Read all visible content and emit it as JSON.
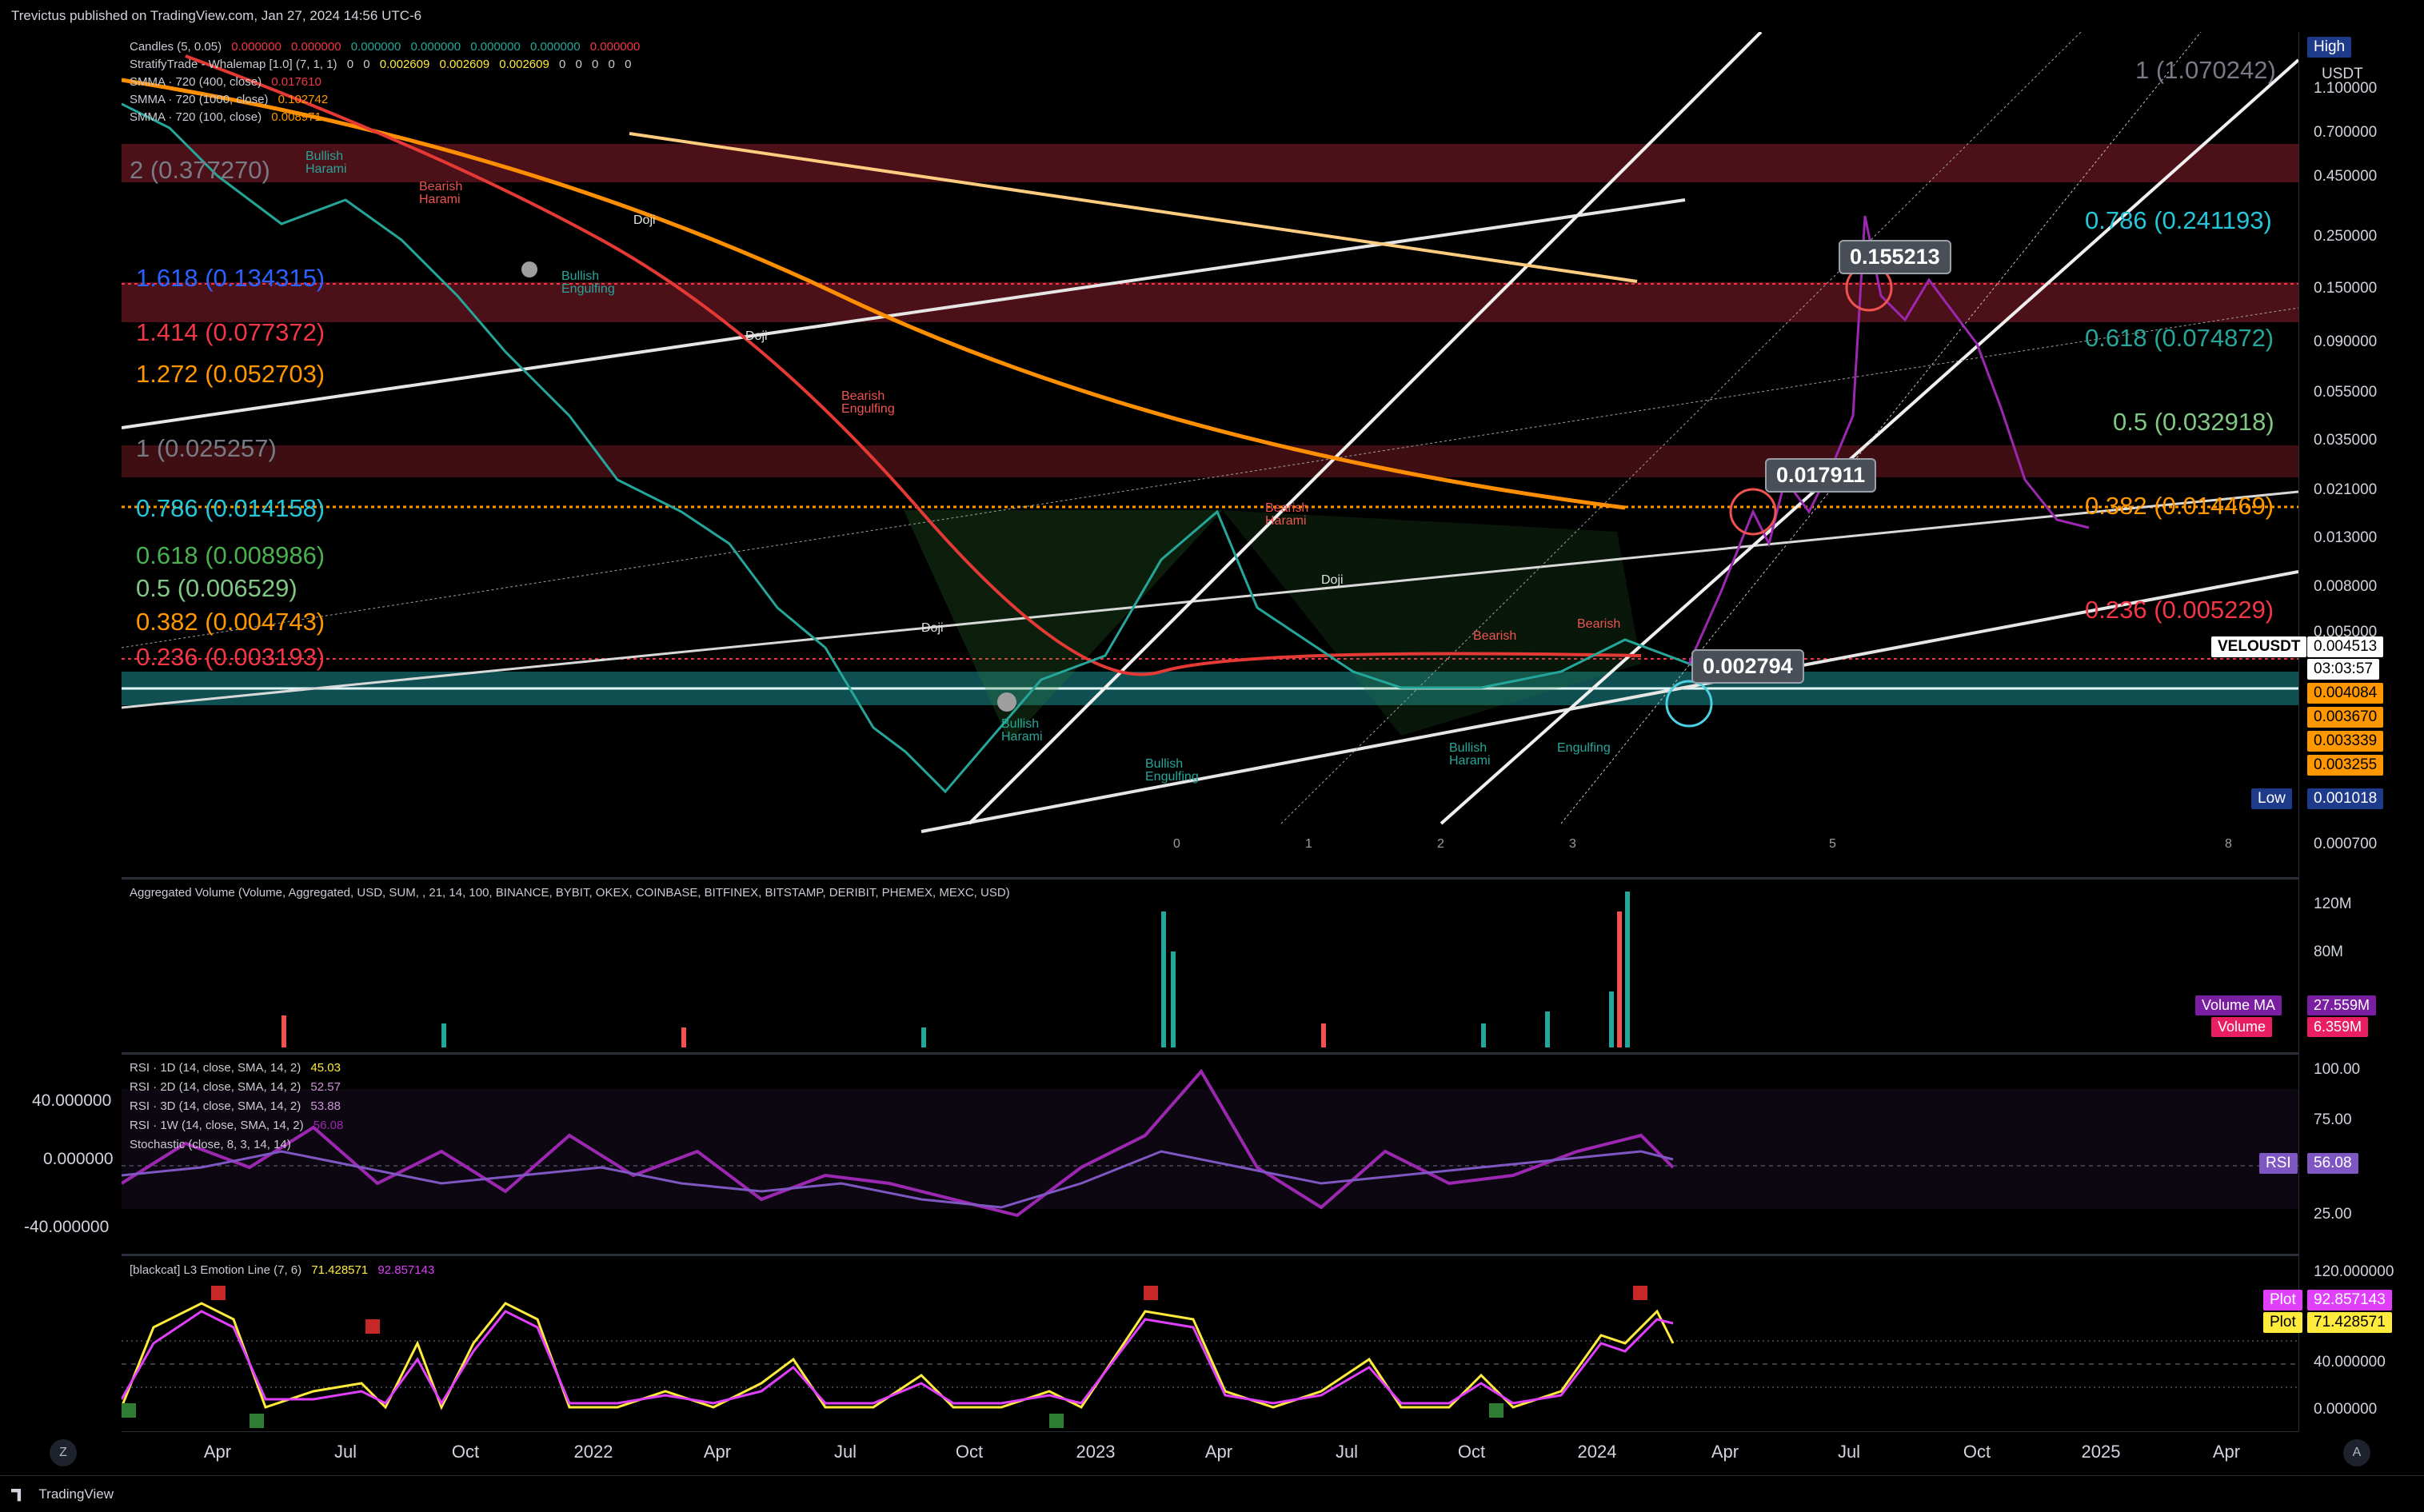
{
  "header": {
    "publisher_text": "Trevictus published on TradingView.com, Jan 27, 2024 14:56 UTC-6"
  },
  "footer": {
    "brand": "TradingView"
  },
  "scale_buttons": {
    "z_left": "Z",
    "a_right": "A"
  },
  "price_axis": {
    "currency": "USDT",
    "high_label": "High",
    "low_label": "Low",
    "low_value": "0.001018",
    "ticks": [
      "1.100000",
      "0.700000",
      "0.450000",
      "0.250000",
      "0.150000",
      "0.090000",
      "0.055000",
      "0.035000",
      "0.021000",
      "0.013000",
      "0.008000",
      "0.005000",
      "0.000700"
    ],
    "symbol_tag": "VELOUSDT",
    "last_price": "0.004513",
    "countdown": "03:03:57",
    "orange_tags": [
      "0.004084",
      "0.003670",
      "0.003339",
      "0.003255"
    ],
    "partial_tag": "0.001018"
  },
  "legend_main": {
    "candles": "Candles (5, 0.05)",
    "candles_values": [
      "0.000000",
      "0.000000",
      "0.000000",
      "0.000000",
      "0.000000",
      "0.000000",
      "0.000000"
    ],
    "strategy": "StratifyTrade - Whalemap [1.0] (7, 1, 1)",
    "strategy_values": [
      "0",
      "0",
      "0.002609",
      "0.002609",
      "0.002609",
      "0",
      "0",
      "0",
      "0",
      "0"
    ],
    "smma1": "SMMA · 720 (400, close)",
    "smma1_value": "0.017610",
    "smma2": "SMMA · 720 (1000, close)",
    "smma2_value": "0.102742",
    "smma3": "SMMA · 720 (100, close)",
    "smma3_value": "0.008971"
  },
  "fib_left": [
    {
      "text": "2 (0.377270)",
      "color": "#787b86"
    },
    {
      "text": "1.618 (0.134315)",
      "color": "#2962ff"
    },
    {
      "text": "1.414 (0.077372)",
      "color": "#f23645"
    },
    {
      "text": "1.272 (0.052703)",
      "color": "#ff9800"
    },
    {
      "text": "1 (0.025257)",
      "color": "#787b86"
    },
    {
      "text": "0.786 (0.014158)",
      "color": "#26c6da"
    },
    {
      "text": "0.618 (0.008986)",
      "color": "#4caf50"
    },
    {
      "text": "0.5 (0.006529)",
      "color": "#81c784"
    },
    {
      "text": "0.382 (0.004743)",
      "color": "#ff9800"
    },
    {
      "text": "0.236 (0.003193)",
      "color": "#f23645"
    }
  ],
  "fib_right": [
    {
      "text": "1 (1.070242)",
      "color": "#787b86"
    },
    {
      "text": "0.786 (0.241193)",
      "color": "#26c6da"
    },
    {
      "text": "0.618 (0.074872)",
      "color": "#26a69a"
    },
    {
      "text": "0.5 (0.032918)",
      "color": "#81c784"
    },
    {
      "text": "0.382 (0.014469)",
      "color": "#ff9800"
    },
    {
      "text": "0.236 (0.005229)",
      "color": "#f23645"
    }
  ],
  "price_callouts": [
    "0.155213",
    "0.017911",
    "0.002794"
  ],
  "pattern_labels": {
    "bullish": "Bullish",
    "bearish": "Bearish",
    "harami": "Harami",
    "engulfing": "Engulfing",
    "doji": "Doji"
  },
  "wave_numbers": [
    "0",
    "1",
    "2",
    "3",
    "5",
    "8"
  ],
  "volume_pane": {
    "legend": "Aggregated Volume (Volume, Aggregated, USD, SUM, , 21, 14, 100, BINANCE, BYBIT, OKEX, COINBASE, BITFINEX, BITSTAMP, DERIBIT, PHEMEX, MEXC, USD)",
    "ticks": [
      "120M",
      "80M"
    ],
    "ma_label": "Volume MA",
    "ma_value": "27.559M",
    "vol_label": "Volume",
    "vol_value": "6.359M"
  },
  "rsi_pane": {
    "legends": [
      {
        "name": "RSI · 1D (14, close, SMA, 14, 2)",
        "value": "45.03"
      },
      {
        "name": "RSI · 2D (14, close, SMA, 14, 2)",
        "value": "52.57"
      },
      {
        "name": "RSI · 3D (14, close, SMA, 14, 2)",
        "value": "53.88"
      },
      {
        "name": "RSI · 1W (14, close, SMA, 14, 2)",
        "value": "56.08"
      },
      {
        "name": "Stochastic (close, 8, 3, 14, 14)",
        "value": ""
      }
    ],
    "left_ticks": [
      "40.000000",
      "0.000000",
      "-40.000000"
    ],
    "right_ticks": [
      "100.00",
      "75.00",
      "25.00"
    ],
    "rsi_tag": "RSI",
    "rsi_value": "56.08"
  },
  "emotion_pane": {
    "legend": "[blackcat] L3 Emotion Line (7, 6)",
    "values": [
      "71.428571",
      "92.857143"
    ],
    "ticks": [
      "120.000000",
      "40.000000",
      "0.000000"
    ],
    "plot_label": "Plot",
    "plot_values": [
      "92.857143",
      "71.428571"
    ],
    "marker_s": "S",
    "marker_b": "B"
  },
  "time_axis": [
    "Apr",
    "Jul",
    "Oct",
    "2022",
    "Apr",
    "Jul",
    "Oct",
    "2023",
    "Apr",
    "Jul",
    "Oct",
    "2024",
    "Apr",
    "Jul",
    "Oct",
    "2025",
    "Apr"
  ],
  "colors": {
    "bull": "#26a69a",
    "bear": "#ef5350",
    "rsi": "#9c27b0",
    "emotion_yellow": "#ffeb3b",
    "emotion_pink": "#e040fb"
  }
}
